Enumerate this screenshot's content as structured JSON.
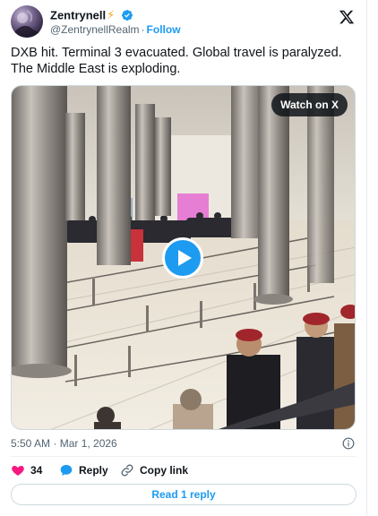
{
  "author": {
    "display_name": "Zentrynell",
    "emoji": "⚡",
    "handle": "@ZentrynellRealm",
    "separator": "·",
    "follow_label": "Follow"
  },
  "tweet": {
    "text": "DXB hit. Terminal 3 evacuated. Global travel is paralyzed. The Middle East is exploding."
  },
  "media": {
    "watch_label": "Watch on X"
  },
  "meta": {
    "timestamp": "5:50 AM · Mar 1, 2026"
  },
  "actions": {
    "like_count": "34",
    "reply_label": "Reply",
    "copy_label": "Copy link"
  },
  "footer": {
    "read_replies_label": "Read 1 reply"
  },
  "colors": {
    "accent": "#1d9bf0",
    "like": "#f91880",
    "text": "#0f1419",
    "muted": "#536471"
  },
  "icons": [
    "verified-badge-icon",
    "x-logo-icon",
    "play-icon",
    "info-icon",
    "heart-icon",
    "reply-bubble-icon",
    "link-icon"
  ]
}
